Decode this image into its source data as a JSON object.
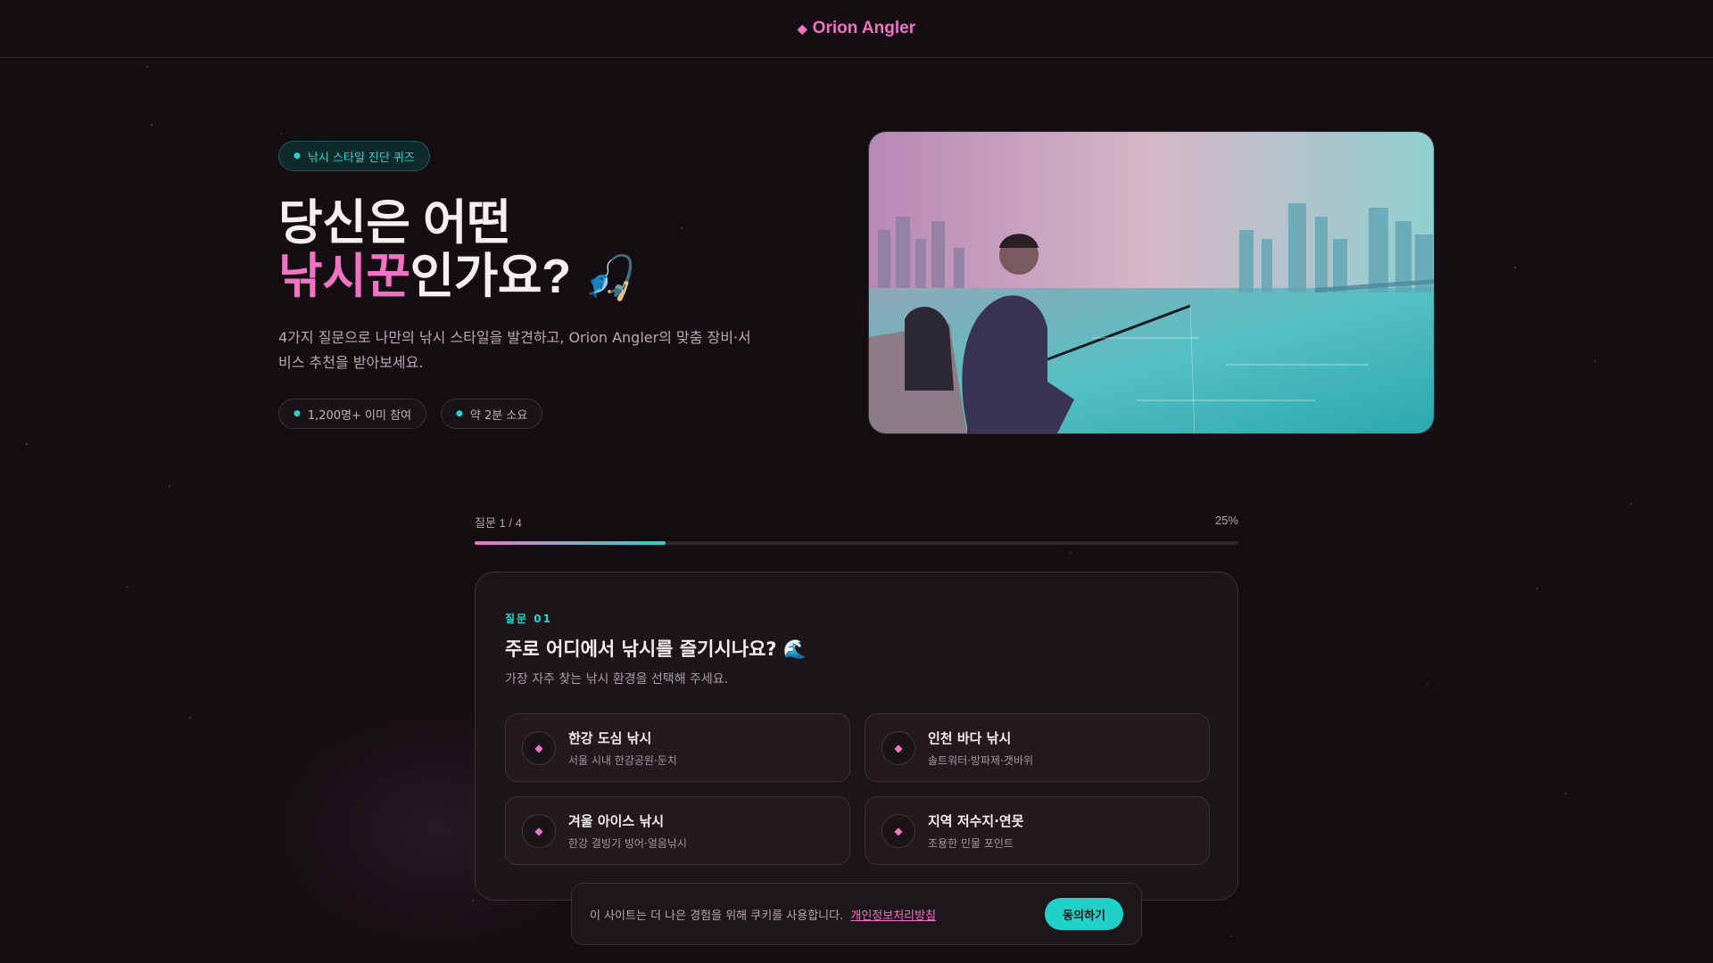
{
  "header": {
    "brand": "Orion Angler",
    "logo_icon": "fish-icon"
  },
  "hero": {
    "badge": "낚시 스타일 진단 퀴즈",
    "headline_line1": "당신은 어떤",
    "headline_highlight": "낚시꾼",
    "headline_rest": "인가요?",
    "headline_emoji": "🎣",
    "lead": "4가지 질문으로 나만의 낚시 스타일을 발견하고, Orion Angler의 맞춤 장비·서비스 추천을 받아보세요.",
    "pills": [
      "1,200명+ 이미 참여",
      "약 2분 소요"
    ],
    "image_alt": "person fishing on a city riverbank"
  },
  "progress": {
    "label": "질문 1 / 4",
    "percent_label": "25%",
    "value": 0.25
  },
  "question": {
    "number_label": "질문 01",
    "title": "주로 어디에서 낚시를 즐기시나요? 🌊",
    "subtitle": "가장 자주 찾는 낚시 환경을 선택해 주세요.",
    "options": [
      {
        "title": "한강 도심 낚시",
        "desc": "서울 시내 한강공원·둔치",
        "icon": "city-icon"
      },
      {
        "title": "인천 바다 낚시",
        "desc": "솔트워터·방파제·갯바위",
        "icon": "wave-icon"
      },
      {
        "title": "겨울 아이스 낚시",
        "desc": "한강 결빙기 빙어·얼음낚시",
        "icon": "snowflake-icon"
      },
      {
        "title": "지역 저수지·연못",
        "desc": "조용한 민물 포인트",
        "icon": "tree-icon"
      }
    ]
  },
  "cookie": {
    "text": "이 사이트는 더 나은 경험을 위해 쿠키를 사용합니다.",
    "link": "개인정보처리방침",
    "button": "동의하기"
  },
  "colors": {
    "accent_pink": "#f072c3",
    "accent_teal": "#27d3cc",
    "background": "#140e12"
  }
}
